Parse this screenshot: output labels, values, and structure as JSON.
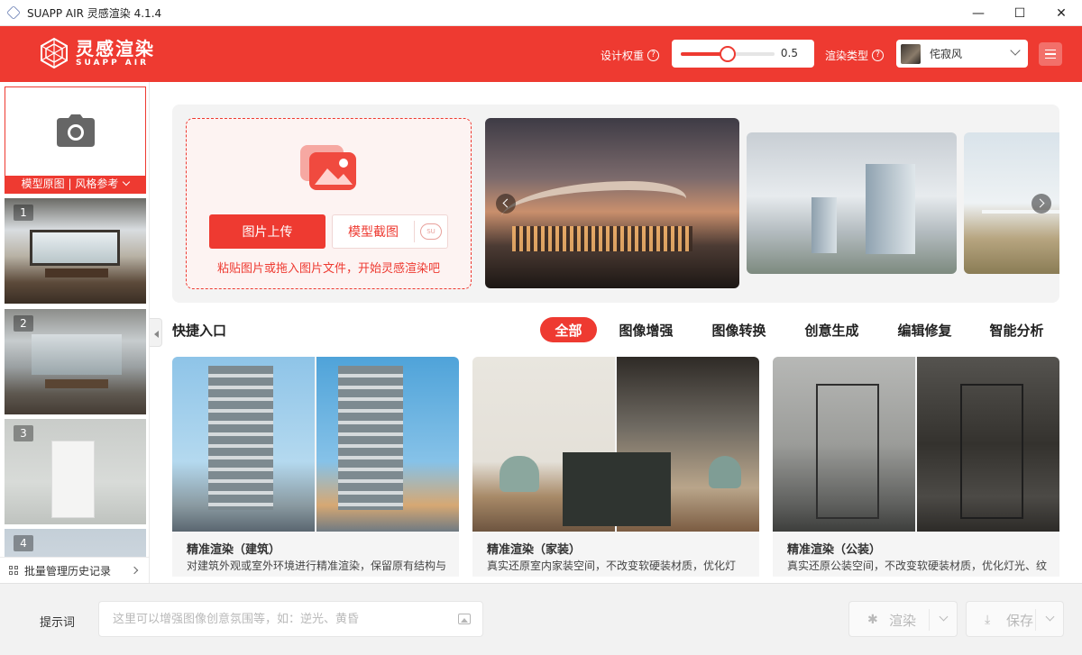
{
  "window": {
    "title": "SUAPP AIR 灵感渲染 4.1.4",
    "minimize": "—",
    "maximize": "☐",
    "close": "✕"
  },
  "header": {
    "logo_cn": "灵感渲染",
    "logo_en": "SUAPP AIR",
    "design_weight_label": "设计权重",
    "design_weight_value": "0.5",
    "design_weight_fraction": 0.5,
    "render_type_label": "渲染类型",
    "render_type_selected": "侘寂风",
    "help_glyph": "?",
    "accent_color": "#ee3a31"
  },
  "sidebar": {
    "upload_caption": "模型原图 | 风格参考",
    "history": [
      {
        "num": "1"
      },
      {
        "num": "2"
      },
      {
        "num": "3"
      },
      {
        "num": "4"
      }
    ],
    "batch_label": "批量管理历史记录"
  },
  "upload": {
    "upload_button": "图片上传",
    "model_button": "模型截图",
    "su_badge": "SU",
    "hint": "粘贴图片或拖入图片文件，开始灵感渲染吧"
  },
  "quick": {
    "title": "快捷入口",
    "tabs": [
      "全部",
      "图像增强",
      "图像转换",
      "创意生成",
      "编辑修复",
      "智能分析"
    ],
    "active_tab": 0,
    "cards": [
      {
        "title": "精准渲染（建筑）",
        "desc": "对建筑外观或室外环境进行精准渲染，保留原有结构与"
      },
      {
        "title": "精准渲染（家装）",
        "desc": "真实还原室内家装空间，不改变软硬装材质，优化灯"
      },
      {
        "title": "精准渲染（公装）",
        "desc": "真实还原公装空间，不改变软硬装材质，优化灯光、纹"
      }
    ]
  },
  "bottom": {
    "prompt_label": "提示词",
    "prompt_placeholder": "这里可以增强图像创意氛围等，如：逆光、黄昏",
    "render_button": "渲染",
    "save_button": "保存"
  }
}
